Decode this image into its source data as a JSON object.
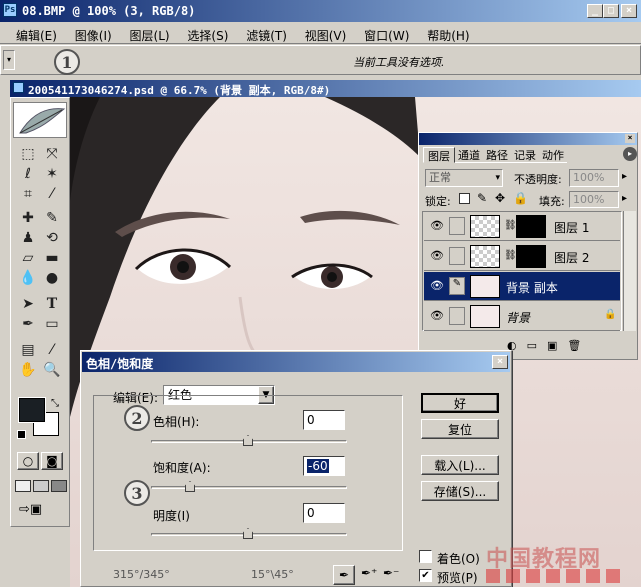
{
  "app": {
    "title": "08.BMP @ 100% (3, RGB/8)",
    "window_buttons": [
      "_",
      "□",
      "×"
    ],
    "menu": [
      "编辑(E)",
      "图像(I)",
      "图层(L)",
      "选择(S)",
      "滤镜(T)",
      "视图(V)",
      "窗口(W)",
      "帮助(H)"
    ],
    "options_text": "当前工具没有选项."
  },
  "document": {
    "title": "20054117304627​4.psd @ 66.7% (背景 副本, RGB/8#)"
  },
  "layers_panel": {
    "tabs": [
      "图层",
      "通道",
      "路径",
      "记录",
      "动作"
    ],
    "blend_mode": "正常",
    "opacity_label": "不透明度:",
    "opacity_value": "100%",
    "lock_label": "锁定:",
    "fill_label": "填充:",
    "fill_value": "100%",
    "layers": [
      {
        "name": "图层 1"
      },
      {
        "name": "图层 2"
      },
      {
        "name": "背景 副本"
      },
      {
        "name": "背景"
      }
    ]
  },
  "dialog": {
    "title": "色相/饱和度",
    "edit_label": "编辑(E):",
    "edit_value": "红色",
    "hue_label": "色相(H):",
    "hue_value": "0",
    "saturation_label": "饱和度(A):",
    "saturation_value": "-60",
    "lightness_label": "明度(I)",
    "lightness_value": "0",
    "ok_label": "好",
    "reset_label": "复位",
    "load_label": "载入(L)...",
    "save_label": "存储(S)...",
    "colorize_label": "着色(O)",
    "preview_label": "预览(P)",
    "range_left": "315°/345°",
    "range_right": "15°\\45°"
  },
  "annotations": [
    "1",
    "2",
    "3"
  ],
  "watermark": "中国教程网"
}
